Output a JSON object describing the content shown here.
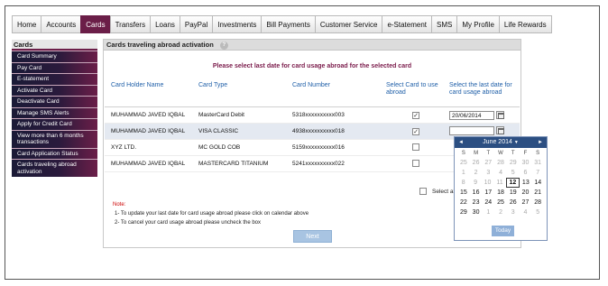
{
  "nav": {
    "tabs": [
      {
        "label": "Home"
      },
      {
        "label": "Accounts"
      },
      {
        "label": "Cards"
      },
      {
        "label": "Transfers"
      },
      {
        "label": "Loans"
      },
      {
        "label": "PayPal"
      },
      {
        "label": "Investments"
      },
      {
        "label": "Bill Payments"
      },
      {
        "label": "Customer Service"
      },
      {
        "label": "e-Statement"
      },
      {
        "label": "SMS"
      },
      {
        "label": "My Profile"
      },
      {
        "label": "Life Rewards"
      }
    ],
    "active_tab": "Cards"
  },
  "sidebar": {
    "title": "Cards",
    "items": [
      {
        "label": "Card Summary"
      },
      {
        "label": "Pay Card"
      },
      {
        "label": "E-statement"
      },
      {
        "label": "Activate Card"
      },
      {
        "label": "Deactivate Card"
      },
      {
        "label": "Manage SMS Alerts"
      },
      {
        "label": "Apply for Credit Card"
      },
      {
        "label": "View more than 6 months transactions"
      },
      {
        "label": "Card Application Status"
      },
      {
        "label": "Cards traveling abroad activation"
      }
    ]
  },
  "main": {
    "title": "Cards traveling abroad activation",
    "help_icon": "?",
    "instruction": "Please select last date for card usage abroad for the selected card",
    "columns": {
      "holder": "Card Holder Name",
      "type": "Card Type",
      "number": "Card Number",
      "select": "Select Card to use abroad",
      "date": "Select the last date for card usage abroad"
    },
    "rows": [
      {
        "holder": "MUHAMMAD JAVED IQBAL",
        "type": "MasterCard Debit",
        "number": "5318xxxxxxxxxx003",
        "checked": true,
        "date": "20/06/2014"
      },
      {
        "holder": "MUHAMMAD JAVED IQBAL",
        "type": "VISA CLASSIC",
        "number": "4938xxxxxxxxxx018",
        "checked": true,
        "date": ""
      },
      {
        "holder": "XYZ LTD.",
        "type": "MC GOLD COB",
        "number": "5159xxxxxxxxxx016",
        "checked": false,
        "date": ""
      },
      {
        "holder": "MUHAMMAD JAVED IQBAL",
        "type": "MASTERCARD TITANIUM",
        "number": "5241xxxxxxxxxx022",
        "checked": false,
        "date": ""
      }
    ],
    "select_all": "Select al",
    "note": {
      "title": "Note:",
      "line1": "1-  To update your last date for card usage abroad please click on calendar above",
      "line2": "2-  To cancel your card usage abroad please uncheck the box"
    },
    "next_label": "Next"
  },
  "calendar": {
    "prev": "◄",
    "next": "►",
    "month": "June 2014",
    "caret": "▼",
    "dow": [
      "S",
      "M",
      "T",
      "W",
      "T",
      "F",
      "S"
    ],
    "weeks": [
      [
        {
          "d": "25",
          "o": true
        },
        {
          "d": "26",
          "o": true
        },
        {
          "d": "27",
          "o": true
        },
        {
          "d": "28",
          "o": true
        },
        {
          "d": "29",
          "o": true
        },
        {
          "d": "30",
          "o": true
        },
        {
          "d": "31",
          "o": true
        }
      ],
      [
        {
          "d": "1",
          "o": true
        },
        {
          "d": "2",
          "o": true
        },
        {
          "d": "3",
          "o": true
        },
        {
          "d": "4",
          "o": true
        },
        {
          "d": "5",
          "o": true
        },
        {
          "d": "6",
          "o": true
        },
        {
          "d": "7",
          "o": true
        }
      ],
      [
        {
          "d": "8",
          "o": true
        },
        {
          "d": "9",
          "o": true
        },
        {
          "d": "10",
          "o": true
        },
        {
          "d": "11",
          "o": true
        },
        {
          "d": "12",
          "t": true
        },
        {
          "d": "13"
        },
        {
          "d": "14"
        }
      ],
      [
        {
          "d": "15"
        },
        {
          "d": "16"
        },
        {
          "d": "17"
        },
        {
          "d": "18"
        },
        {
          "d": "19"
        },
        {
          "d": "20"
        },
        {
          "d": "21"
        }
      ],
      [
        {
          "d": "22"
        },
        {
          "d": "23"
        },
        {
          "d": "24"
        },
        {
          "d": "25"
        },
        {
          "d": "26"
        },
        {
          "d": "27"
        },
        {
          "d": "28"
        }
      ],
      [
        {
          "d": "29"
        },
        {
          "d": "30"
        },
        {
          "d": "1",
          "o": true
        },
        {
          "d": "2",
          "o": true
        },
        {
          "d": "3",
          "o": true
        },
        {
          "d": "4",
          "o": true
        },
        {
          "d": "5",
          "o": true
        }
      ]
    ],
    "today_label": "Today"
  },
  "colors": {
    "brand": "#6b1e48",
    "header_blue": "#2c4f82",
    "link_blue": "#1f5fa8"
  }
}
